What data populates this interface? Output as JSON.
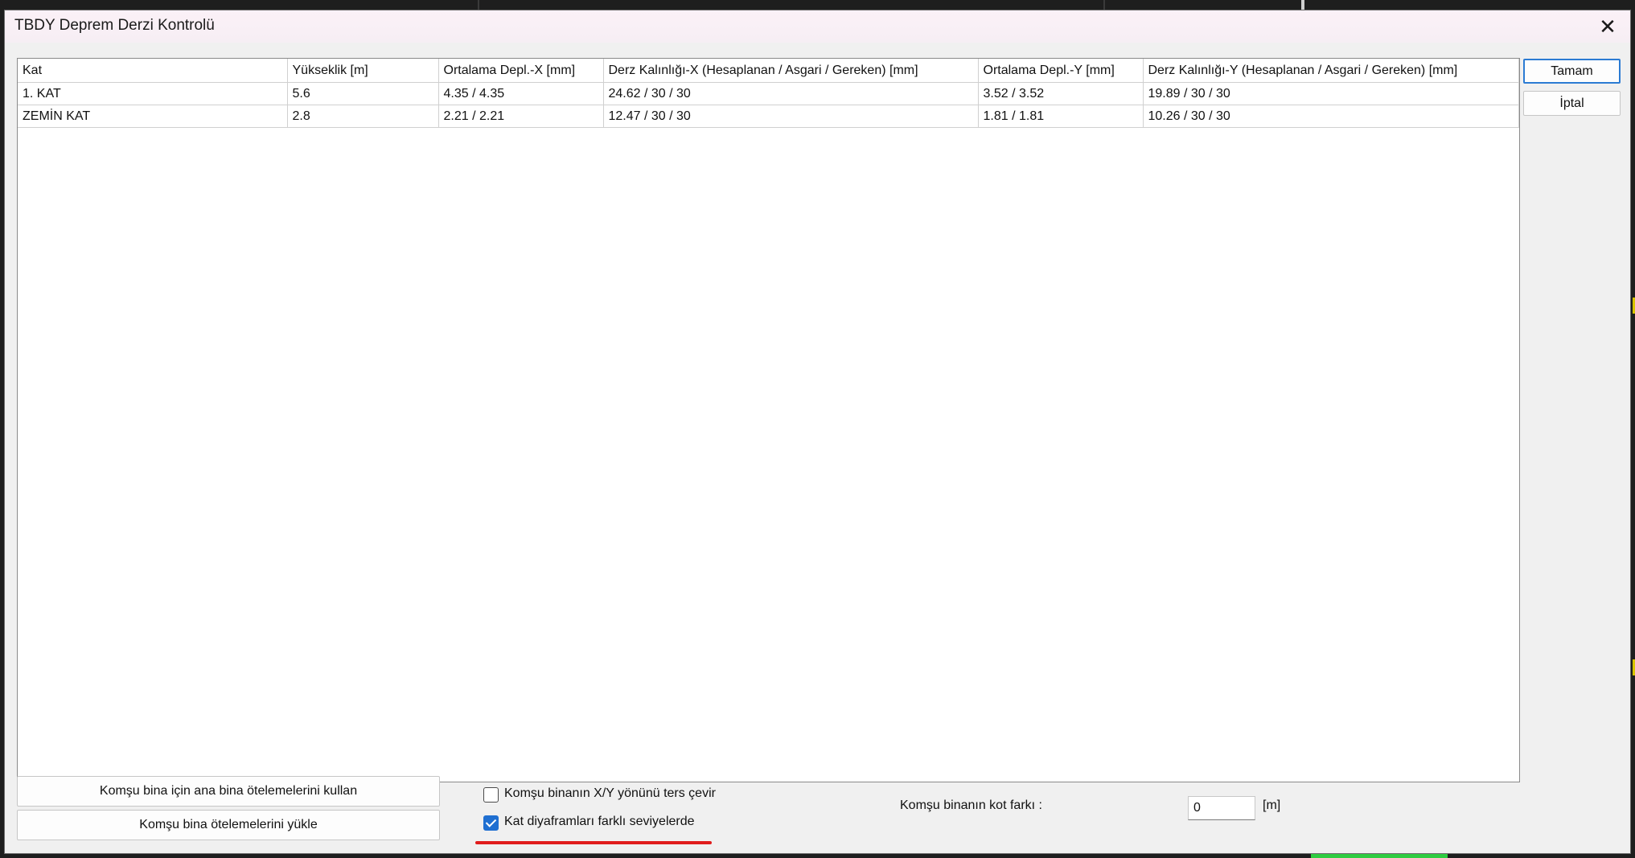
{
  "dialog": {
    "title": "TBDY Deprem Derzi Kontrolü",
    "close_glyph": "✕"
  },
  "table": {
    "headers": [
      "Kat",
      "Yükseklik [m]",
      "Ortalama Depl.-X [mm]",
      "Derz Kalınlığı-X (Hesaplanan / Asgari / Gereken) [mm]",
      "Ortalama Depl.-Y [mm]",
      "Derz Kalınlığı-Y (Hesaplanan / Asgari / Gereken) [mm]"
    ],
    "rows": [
      [
        "1. KAT",
        "5.6",
        "4.35 / 4.35",
        "24.62 / 30 / 30",
        "3.52 / 3.52",
        "19.89 / 30 / 30"
      ],
      [
        "ZEMİN KAT",
        "2.8",
        "2.21 / 2.21",
        "12.47 / 30 / 30",
        "1.81 / 1.81",
        "10.26 / 30 / 30"
      ]
    ]
  },
  "buttons": {
    "ok": "Tamam",
    "cancel": "İptal",
    "use_main": "Komşu bina için ana bina ötelemelerini kullan",
    "load": "Komşu bina ötelemelerini yükle"
  },
  "options": {
    "reverse_xy_label": "Komşu binanın X/Y yönünü ters çevir",
    "reverse_xy_checked": false,
    "diaphragm_label": "Kat diyaframları farklı seviyelerde",
    "diaphragm_checked": true
  },
  "elevation": {
    "label": "Komşu binanın kot farkı :",
    "value": "0",
    "unit": "[m]"
  },
  "colors": {
    "accent": "#1f6fd1",
    "highlight_underline": "#e01c1c"
  }
}
